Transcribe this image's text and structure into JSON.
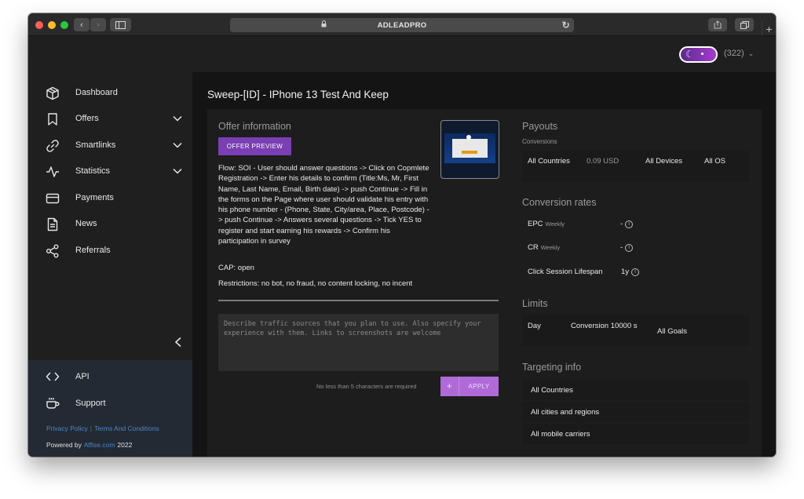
{
  "browser": {
    "url": "ADLEADPRO"
  },
  "header": {
    "account_count": "(322)"
  },
  "sidebar": {
    "items": [
      {
        "label": "Dashboard",
        "icon": "cube-icon"
      },
      {
        "label": "Offers",
        "icon": "bookmark-icon",
        "expandable": true
      },
      {
        "label": "Smartlinks",
        "icon": "link-icon",
        "expandable": true
      },
      {
        "label": "Statistics",
        "icon": "activity-icon",
        "expandable": true
      },
      {
        "label": "Payments",
        "icon": "credit-card-icon"
      },
      {
        "label": "News",
        "icon": "document-icon"
      },
      {
        "label": "Referrals",
        "icon": "share-icon"
      }
    ],
    "bottom": [
      {
        "label": "API",
        "icon": "code-icon"
      },
      {
        "label": "Support",
        "icon": "cup-icon"
      }
    ],
    "privacy": "Privacy Policy",
    "terms": "Terms And Conditions",
    "powered_prefix": "Powered by",
    "powered_link": "Affise.com",
    "year": "2022"
  },
  "offer": {
    "title": "Sweep-[ID] - IPhone 13 Test And Keep",
    "info_title": "Offer information",
    "preview_button": "OFFER PREVIEW",
    "flow": "Flow: SOI - User should answer questions -> Click on Copmlete Registration -> Enter his details to confirm (Title:Ms, Mr, First Name, Last Name, Email, Birth date) -> push Continue -> Fill in the forms on the Page where user should validate his entry with his phone number - (Phone, State, City/area, Place, Postcode) -> push Continue -> Answers several questions -> Tick YES to register and start earning his rewards -> Confirm his participation in survey",
    "cap": "CAP: open",
    "restrictions": "Restrictions: no bot, no fraud, no content locking, no incent",
    "traffic_placeholder": "Describe traffic sources that you plan to use. Also specify your experience with them. Links to screenshots are welcome",
    "hint": "No less than 5 characters are required",
    "apply_button": "APPLY"
  },
  "payouts": {
    "title": "Payouts",
    "subtitle": "Conversions",
    "countries": "All Countries",
    "amount": "0.09 USD",
    "devices": "All Devices",
    "os": "All OS"
  },
  "conversion_rates": {
    "title": "Conversion rates",
    "epc_label": "EPC",
    "epc_period": "Weekly",
    "epc_value": "-",
    "cr_label": "CR",
    "cr_period": "Weekly",
    "cr_value": "-",
    "session_label": "Click Session Lifespan",
    "session_value": "1y"
  },
  "limits": {
    "title": "Limits",
    "period": "Day",
    "value": "Conversion 10000 s",
    "goals": "All Goals"
  },
  "targeting": {
    "title": "Targeting info",
    "items": [
      "All Countries",
      "All cities and regions",
      "All mobile carriers"
    ]
  },
  "colors": {
    "accent": "#7a3fb3",
    "apply": "#b06ad8",
    "link": "#4a86c8"
  }
}
